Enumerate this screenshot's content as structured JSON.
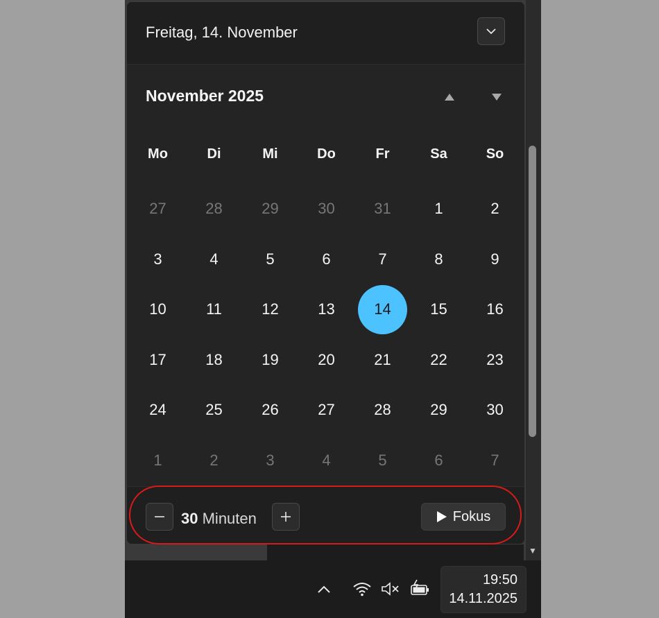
{
  "header": {
    "date_label": "Freitag, 14. November"
  },
  "calendar": {
    "month_title": "November 2025",
    "weekdays": [
      "Mo",
      "Di",
      "Mi",
      "Do",
      "Fr",
      "Sa",
      "So"
    ],
    "days": [
      {
        "label": "27",
        "muted": true
      },
      {
        "label": "28",
        "muted": true
      },
      {
        "label": "29",
        "muted": true
      },
      {
        "label": "30",
        "muted": true
      },
      {
        "label": "31",
        "muted": true
      },
      {
        "label": "1"
      },
      {
        "label": "2"
      },
      {
        "label": "3"
      },
      {
        "label": "4"
      },
      {
        "label": "5"
      },
      {
        "label": "6"
      },
      {
        "label": "7"
      },
      {
        "label": "8"
      },
      {
        "label": "9"
      },
      {
        "label": "10"
      },
      {
        "label": "11"
      },
      {
        "label": "12"
      },
      {
        "label": "13"
      },
      {
        "label": "14",
        "today": true
      },
      {
        "label": "15"
      },
      {
        "label": "16"
      },
      {
        "label": "17"
      },
      {
        "label": "18"
      },
      {
        "label": "19"
      },
      {
        "label": "20"
      },
      {
        "label": "21"
      },
      {
        "label": "22"
      },
      {
        "label": "23"
      },
      {
        "label": "24"
      },
      {
        "label": "25"
      },
      {
        "label": "26"
      },
      {
        "label": "27"
      },
      {
        "label": "28"
      },
      {
        "label": "29"
      },
      {
        "label": "30"
      },
      {
        "label": "1",
        "muted": true
      },
      {
        "label": "2",
        "muted": true
      },
      {
        "label": "3",
        "muted": true
      },
      {
        "label": "4",
        "muted": true
      },
      {
        "label": "5",
        "muted": true
      },
      {
        "label": "6",
        "muted": true
      },
      {
        "label": "7",
        "muted": true
      }
    ],
    "accent_color": "#4cc2ff"
  },
  "focus": {
    "duration_value": "30",
    "duration_unit": "Minuten",
    "focus_label": "Fokus"
  },
  "taskbar": {
    "time": "19:50",
    "date": "14.11.2025",
    "icons": [
      "chevron-up-icon",
      "wifi-icon",
      "speaker-muted-icon",
      "battery-charging-icon"
    ]
  }
}
